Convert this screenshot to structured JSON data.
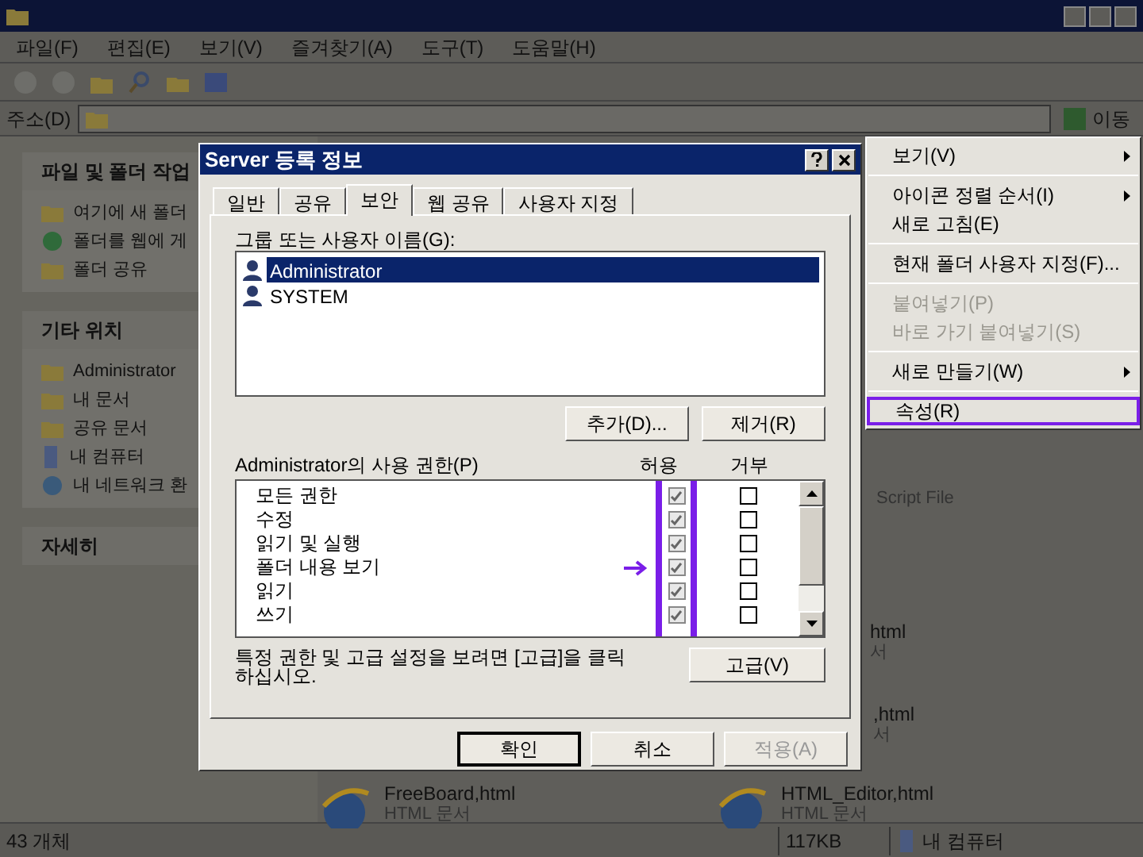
{
  "menu_bar": [
    "파일(F)",
    "편집(E)",
    "보기(V)",
    "즐겨찾기(A)",
    "도구(T)",
    "도움말(H)"
  ],
  "address": {
    "label": "주소(D)",
    "go": "이동"
  },
  "task_panels": [
    {
      "title": "파일 및 폴더 작업",
      "items": [
        {
          "label": "여기에 새 폴더"
        },
        {
          "label": "폴더를 웹에 게"
        },
        {
          "label": "폴더 공유"
        }
      ]
    },
    {
      "title": "기타 위치",
      "items": [
        {
          "label": "Administrator"
        },
        {
          "label": "내 문서"
        },
        {
          "label": "공유 문서"
        },
        {
          "label": "내 컴퓨터"
        },
        {
          "label": "내 네트워크 환"
        }
      ]
    },
    {
      "title": "자세히"
    }
  ],
  "files": [
    {
      "type": "Script File"
    },
    {
      "name": "html",
      "type": "서"
    },
    {
      "name": ",html",
      "type": "서"
    },
    {
      "name": "FreeBoard,html",
      "type": "HTML 문서"
    },
    {
      "name": "HTML_Editor,html",
      "type": "HTML 문서"
    }
  ],
  "dialog": {
    "title": "Server 등록 정보",
    "tabs": [
      {
        "label": "일반",
        "selected": false
      },
      {
        "label": "공유",
        "selected": false
      },
      {
        "label": "보안",
        "selected": true
      },
      {
        "label": "웹 공유",
        "selected": false
      },
      {
        "label": "사용자 지정",
        "selected": false
      }
    ],
    "users_label": "그룹 또는 사용자 이름(G):",
    "users": [
      {
        "name": "Administrator",
        "selected": true
      },
      {
        "name": "SYSTEM",
        "selected": false
      }
    ],
    "add_button": "추가(D)...",
    "remove_button": "제거(R)",
    "perm_label": "Administrator의 사용 권한(P)",
    "allow_heading": "허용",
    "deny_heading": "거부",
    "allow_frame": true,
    "permissions": [
      {
        "name": "모든 권한",
        "allow": true,
        "deny": false
      },
      {
        "name": "수정",
        "allow": true,
        "deny": false
      },
      {
        "name": "읽기 및 실행",
        "allow": true,
        "deny": false
      },
      {
        "name": "폴더 내용 보기",
        "allow": true,
        "deny": false,
        "arrow": true
      },
      {
        "name": "읽기",
        "allow": true,
        "deny": false
      },
      {
        "name": "쓰기",
        "allow": true,
        "deny": false
      }
    ],
    "hint": "특정 권한 및 고급 설정을 보려면 [고급]을 클릭하십시오.",
    "advanced_button": "고급(V)",
    "buttons": [
      {
        "label": "확인",
        "disabled": false,
        "default": true
      },
      {
        "label": "취소",
        "disabled": false,
        "default": false
      },
      {
        "label": "적용(A)",
        "disabled": true,
        "default": false
      }
    ]
  },
  "context_menu": [
    {
      "kind": "item",
      "label": "보기(V)",
      "submenu": true,
      "disabled": false,
      "framed": false
    },
    {
      "kind": "separator"
    },
    {
      "kind": "item",
      "label": "아이콘 정렬 순서(I)",
      "submenu": true,
      "disabled": false,
      "framed": false
    },
    {
      "kind": "item",
      "label": "새로 고침(E)",
      "submenu": false,
      "disabled": false,
      "framed": false
    },
    {
      "kind": "separator"
    },
    {
      "kind": "item",
      "label": "현재 폴더 사용자 지정(F)...",
      "submenu": false,
      "disabled": false,
      "framed": false
    },
    {
      "kind": "separator"
    },
    {
      "kind": "item",
      "label": "붙여넣기(P)",
      "submenu": false,
      "disabled": true,
      "framed": false
    },
    {
      "kind": "item",
      "label": "바로 가기 붙여넣기(S)",
      "submenu": false,
      "disabled": true,
      "framed": false
    },
    {
      "kind": "separator"
    },
    {
      "kind": "item",
      "label": "새로 만들기(W)",
      "submenu": true,
      "disabled": false,
      "framed": false
    },
    {
      "kind": "separator"
    },
    {
      "kind": "item",
      "label": "속성(R)",
      "submenu": false,
      "disabled": false,
      "framed": true
    }
  ],
  "status_bar": {
    "objects": "43 개체",
    "size": "117KB",
    "zone": "내 컴퓨터"
  }
}
